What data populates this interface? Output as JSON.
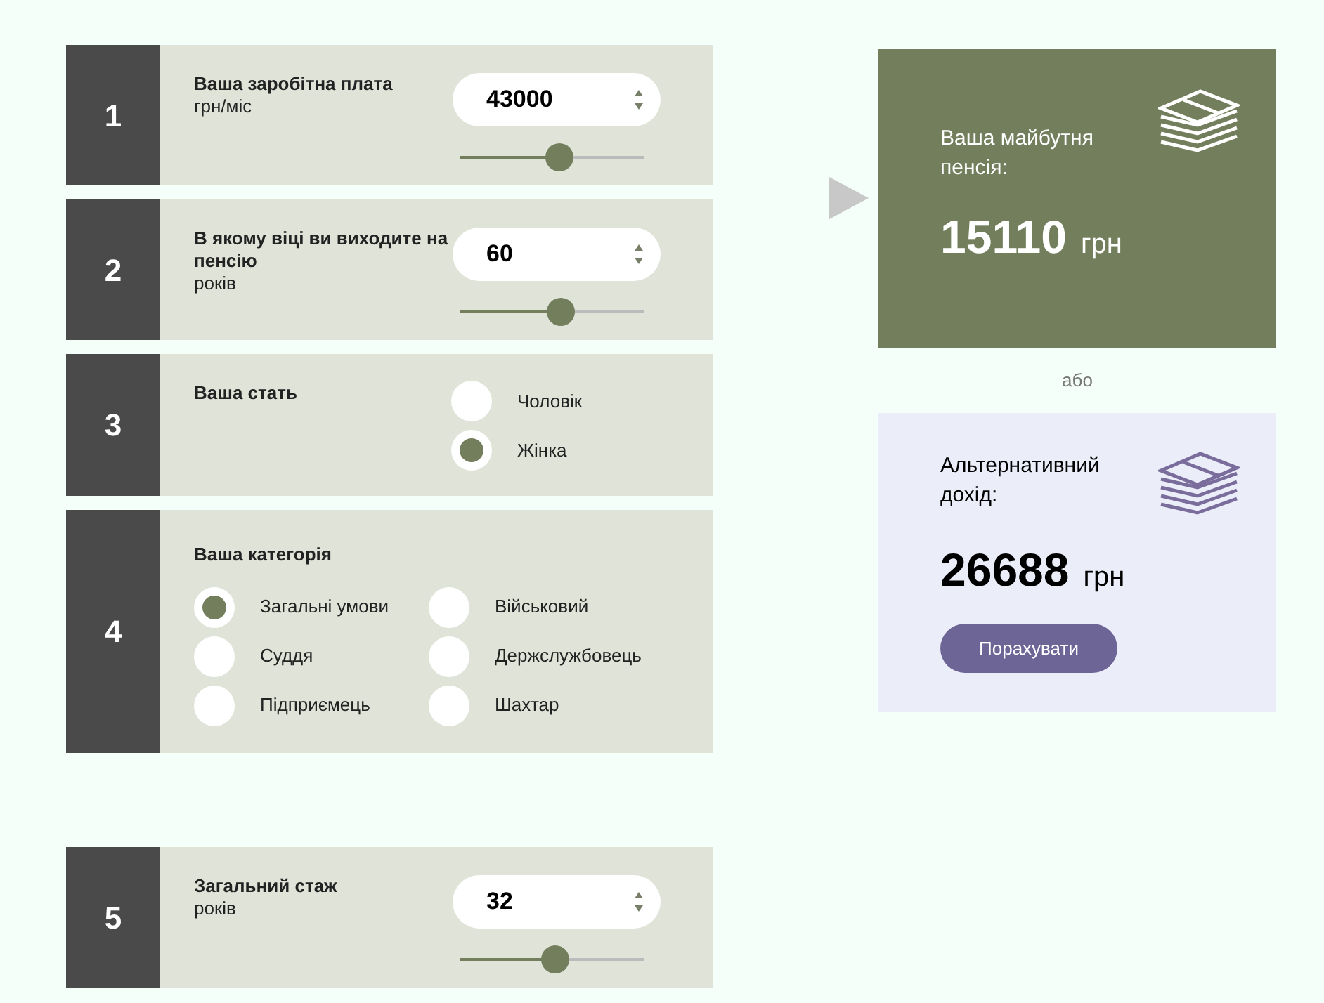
{
  "steps": [
    {
      "number": "1",
      "kind": "number",
      "title": "Ваша заробітна плата",
      "unit": "грн/міс",
      "value": "43000",
      "level": 0.54
    },
    {
      "number": "2",
      "kind": "number",
      "title": "В якому віці ви виходите на пенсію",
      "unit": "років",
      "value": "60",
      "level": 0.55
    },
    {
      "number": "3",
      "kind": "radio",
      "title": "Ваша стать",
      "options": [
        {
          "label": "Чоловік",
          "selected": false
        },
        {
          "label": "Жінка",
          "selected": true
        }
      ]
    },
    {
      "number": "4",
      "kind": "radio_grid",
      "title": "Ваша категорія",
      "options": [
        {
          "label": "Загальні умови",
          "selected": true
        },
        {
          "label": "Військовий",
          "selected": false
        },
        {
          "label": "Суддя",
          "selected": false
        },
        {
          "label": "Держслужбовець",
          "selected": false
        },
        {
          "label": "Підприємець",
          "selected": false
        },
        {
          "label": "Шахтар",
          "selected": false
        }
      ]
    },
    {
      "number": "5",
      "kind": "number",
      "title": "Загальний стаж",
      "unit": "років",
      "value": "32",
      "level": 0.52
    }
  ],
  "pension": {
    "label": "Ваша майбутня пенсія:",
    "amount": "15110",
    "currency": "грн"
  },
  "separator": "або",
  "alternative": {
    "label": "Альтернативний дохід:",
    "amount": "26688",
    "currency": "грн",
    "button": "Порахувати"
  }
}
